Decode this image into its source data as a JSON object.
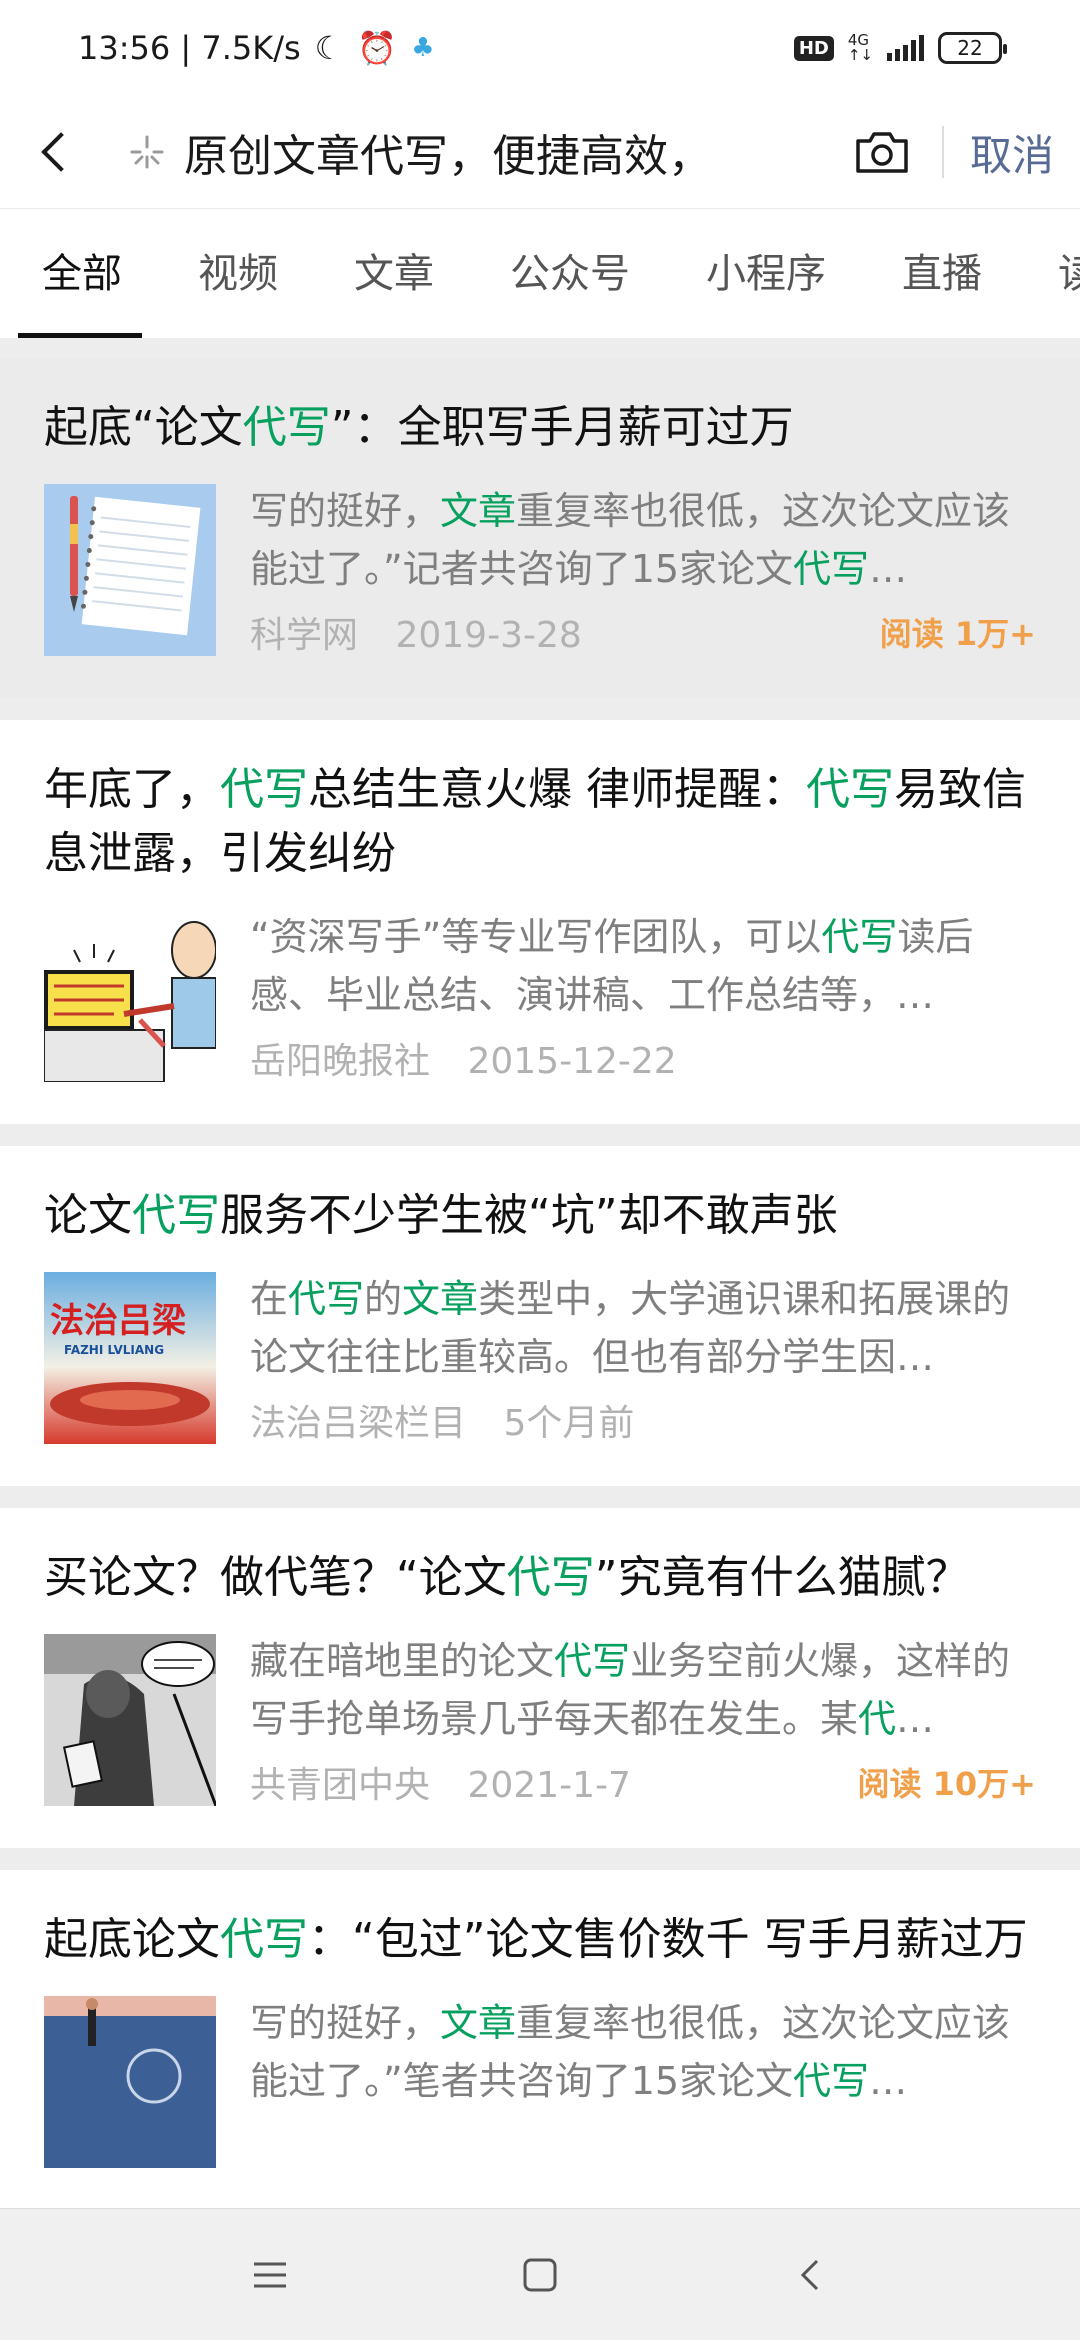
{
  "status_bar": {
    "time_speed": "13:56 | 7.5K/s",
    "hd": "HD",
    "net_top": "4G",
    "net_bottom": "↑↓",
    "battery": "22"
  },
  "search": {
    "query": "原创文章代写，便捷高效，",
    "cancel_label": "取消"
  },
  "tabs": [
    "全部",
    "视频",
    "文章",
    "公众号",
    "小程序",
    "直播",
    "读"
  ],
  "results": [
    {
      "title_pre": "起底“论文",
      "title_hl": "代写",
      "title_post": "”：全职写手月薪可过万",
      "snippet_1": "写的挺好，",
      "snippet_hl1": "文章",
      "snippet_2": "重复率也很低，这次论文应该能过了。”记者共咨询了15家论文",
      "snippet_hl2": "代写",
      "snippet_3": "…",
      "source": "科学网",
      "date": "2019-3-28",
      "reads": "阅读 1万+",
      "thumb": "notebook-thumb"
    },
    {
      "title_pre": "年底了，",
      "title_hl": "代写",
      "title_mid": "总结生意火爆 律师提醒：",
      "title_hl2": "代写",
      "title_post": "易致信息泄露，引发纠纷",
      "snippet_1": "“资深写手”等专业写作团队，可以",
      "snippet_hl1": "代写",
      "snippet_2": "读后感、毕业总结、演讲稿、工作总结等，…",
      "source": "岳阳晚报社",
      "date": "2015-12-22",
      "thumb": "cartoon-thumb"
    },
    {
      "title_pre": "论文",
      "title_hl": "代写",
      "title_post": "服务不少学生被“坑”却不敢声张",
      "snippet_1": "在",
      "snippet_hl1": "代写",
      "snippet_2": "的",
      "snippet_hl2": "文章",
      "snippet_3": "类型中，大学通识课和拓展课的论文往往比重较高。但也有部分学生因…",
      "source": "法治吕梁栏目",
      "date": "5个月前",
      "thumb": "tv-logo-thumb",
      "thumb_text": "法治吕梁",
      "thumb_sub": "FAZHI LVLIANG"
    },
    {
      "title_pre": "买论文？做代笔？“论文",
      "title_hl": "代写",
      "title_post": "”究竟有什么猫腻？",
      "snippet_1": "藏在暗地里的论文",
      "snippet_hl1": "代写",
      "snippet_2": "业务空前火爆，这样的写手抢单场景几乎每天都在发生。某",
      "snippet_hl2": "代",
      "snippet_3": "…",
      "source": "共青团中央",
      "date": "2021-1-7",
      "reads": "阅读 10万+",
      "thumb": "comic-thumb"
    },
    {
      "title_pre": "起底论文",
      "title_hl": "代写",
      "title_post": "：“包过”论文售价数千 写手月薪过万",
      "snippet_1": "写的挺好，",
      "snippet_hl1": "文章",
      "snippet_2": "重复率也很低，这次论文应该能过了。”笔者共咨询了15家论文",
      "snippet_hl2": "代写",
      "snippet_3": "…",
      "thumb": "money-thumb"
    }
  ]
}
